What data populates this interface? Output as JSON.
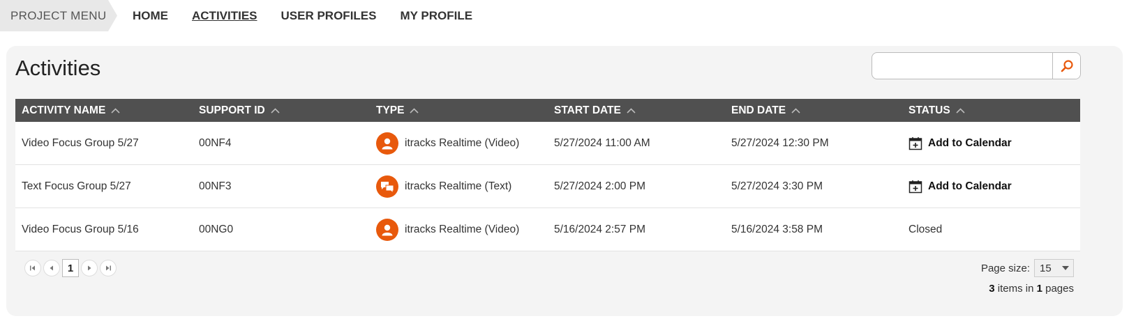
{
  "nav": {
    "project_menu": "PROJECT MENU",
    "links": [
      {
        "label": "HOME"
      },
      {
        "label": "ACTIVITIES"
      },
      {
        "label": "USER PROFILES"
      },
      {
        "label": "MY PROFILE"
      }
    ],
    "active": "ACTIVITIES"
  },
  "page": {
    "title": "Activities"
  },
  "search": {
    "value": "",
    "placeholder": ""
  },
  "table": {
    "headers": [
      "ACTIVITY NAME",
      "SUPPORT ID",
      "TYPE",
      "START DATE",
      "END DATE",
      "STATUS"
    ],
    "rows": [
      {
        "name": "Video Focus Group 5/27",
        "support_id": "00NF4",
        "type": "itracks Realtime (Video)",
        "type_icon": "person-icon",
        "start": "5/27/2024 11:00 AM",
        "end": "5/27/2024 12:30 PM",
        "status": "Add to Calendar",
        "status_is_link": true
      },
      {
        "name": "Text Focus Group 5/27",
        "support_id": "00NF3",
        "type": "itracks Realtime (Text)",
        "type_icon": "chat-bubbles-icon",
        "start": "5/27/2024 2:00 PM",
        "end": "5/27/2024 3:30 PM",
        "status": "Add to Calendar",
        "status_is_link": true
      },
      {
        "name": "Video Focus Group 5/16",
        "support_id": "00NG0",
        "type": "itracks Realtime (Video)",
        "type_icon": "person-icon",
        "start": "5/16/2024 2:57 PM",
        "end": "5/16/2024 3:58 PM",
        "status": "Closed",
        "status_is_link": false
      }
    ]
  },
  "pager": {
    "current_page": "1",
    "page_size_label": "Page size:",
    "page_size": "15",
    "items": "3",
    "items_mid": "items in",
    "pages": "1",
    "pages_label": "pages"
  },
  "colors": {
    "accent": "#e8590c",
    "header_bg": "#505050",
    "panel_bg": "#f4f4f4"
  }
}
